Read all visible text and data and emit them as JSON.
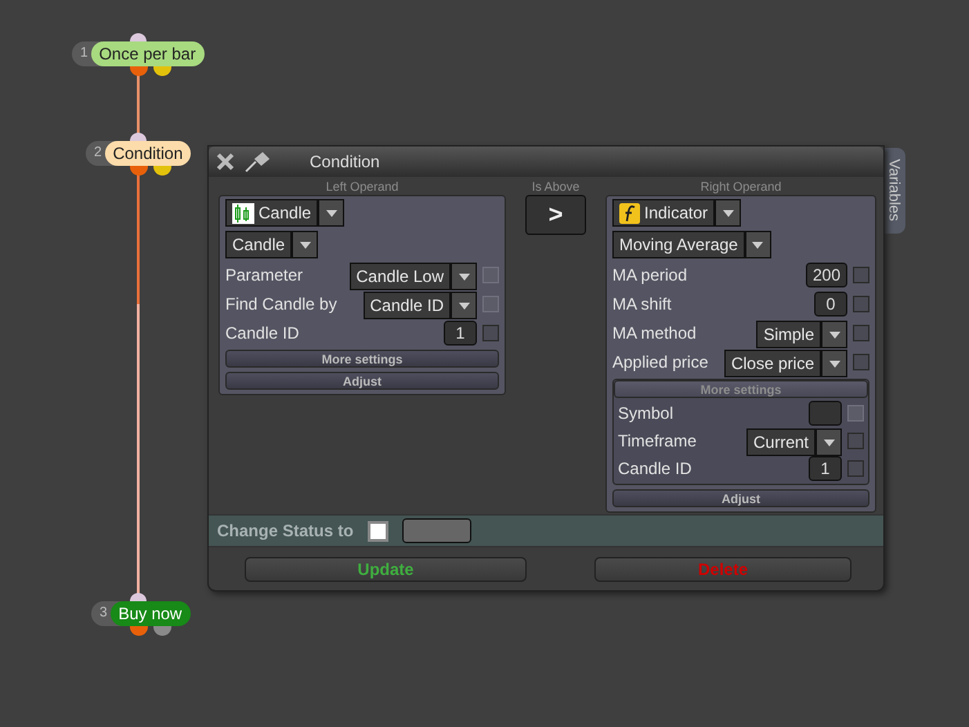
{
  "nodes": [
    {
      "number": "1",
      "label": "Once per bar",
      "color": "#a8da80",
      "ports": [
        {
          "color": "#e8610a"
        },
        {
          "color": "#e3c20c"
        }
      ]
    },
    {
      "number": "2",
      "label": "Condition",
      "color": "#fcdcaa",
      "ports": [
        {
          "color": "#e8610a"
        },
        {
          "color": "#e3c20c"
        }
      ]
    },
    {
      "number": "3",
      "label": "Buy now",
      "color": "#178a17",
      "ports": [
        {
          "color": "#e8610a"
        },
        {
          "color": "#8a8a8a"
        }
      ]
    }
  ],
  "dialog": {
    "title": "Condition",
    "side_tab": "Variables",
    "left": {
      "caption": "Left Operand",
      "type": "Candle",
      "subtype": "Candle",
      "rows": [
        {
          "kind": "select",
          "label": "Parameter",
          "value": "Candle Low",
          "checked": false,
          "disabled": true
        },
        {
          "kind": "select",
          "label": "Find Candle by",
          "value": "Candle ID",
          "checked": false,
          "disabled": true
        },
        {
          "kind": "number",
          "label": "Candle ID",
          "value": "1",
          "checked": false,
          "disabled": false
        }
      ],
      "buttons": [
        "More settings",
        "Adjust"
      ]
    },
    "comparator": {
      "caption": "Is Above",
      "symbol": ">"
    },
    "right": {
      "caption": "Right Operand",
      "type": "Indicator",
      "subtype": "Moving Average",
      "rows": [
        {
          "kind": "number",
          "label": "MA period",
          "value": "200",
          "checked": false,
          "disabled": false
        },
        {
          "kind": "number",
          "label": "MA shift",
          "value": "0",
          "checked": false,
          "disabled": false
        },
        {
          "kind": "select",
          "label": "MA method",
          "value": "Simple",
          "checked": false,
          "disabled": false
        },
        {
          "kind": "select",
          "label": "Applied price",
          "value": "Close price",
          "checked": false,
          "disabled": false
        }
      ],
      "more": {
        "label": "More settings",
        "expanded": true,
        "rows": [
          {
            "kind": "text",
            "label": "Symbol",
            "checked": false,
            "disabled": true
          },
          {
            "kind": "select",
            "label": "Timeframe",
            "value": "Current",
            "checked": false,
            "disabled": false
          },
          {
            "kind": "number",
            "label": "Candle ID",
            "value": "1",
            "checked": false,
            "disabled": false
          }
        ]
      },
      "adjust": "Adjust"
    },
    "status": {
      "label": "Change Status to",
      "checked": false
    },
    "actions": [
      {
        "kind": "update",
        "label": "Update"
      },
      {
        "kind": "delete",
        "label": "Delete"
      }
    ]
  }
}
